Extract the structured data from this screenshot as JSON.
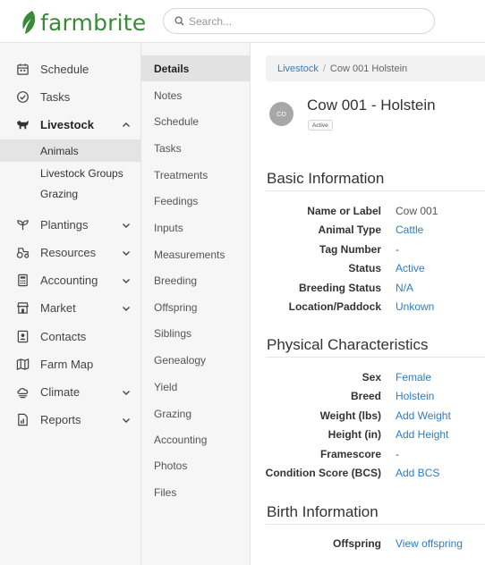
{
  "logo": {
    "text": "farmbrite"
  },
  "search": {
    "placeholder": "Search..."
  },
  "sidebar": {
    "items": [
      {
        "label": "Schedule",
        "icon": "calendar-icon"
      },
      {
        "label": "Tasks",
        "icon": "check-circle-icon"
      },
      {
        "label": "Livestock",
        "icon": "livestock-icon",
        "expanded": true
      },
      {
        "label": "Plantings",
        "icon": "sprout-icon"
      },
      {
        "label": "Resources",
        "icon": "tractor-icon"
      },
      {
        "label": "Accounting",
        "icon": "calculator-icon"
      },
      {
        "label": "Market",
        "icon": "market-icon"
      },
      {
        "label": "Contacts",
        "icon": "contact-icon"
      },
      {
        "label": "Farm Map",
        "icon": "map-icon"
      },
      {
        "label": "Climate",
        "icon": "cloud-icon"
      },
      {
        "label": "Reports",
        "icon": "report-icon"
      }
    ],
    "livestock_sub": [
      {
        "label": "Animals"
      },
      {
        "label": "Livestock Groups"
      },
      {
        "label": "Grazing"
      }
    ]
  },
  "subnav": {
    "items": [
      "Details",
      "Notes",
      "Schedule",
      "Tasks",
      "Treatments",
      "Feedings",
      "Inputs",
      "Measurements",
      "Breeding",
      "Offspring",
      "Siblings",
      "Genealogy",
      "Yield",
      "Grazing",
      "Accounting",
      "Photos",
      "Files"
    ]
  },
  "breadcrumb": {
    "link": "Livestock",
    "separator": "/",
    "current": "Cow 001 Holstein"
  },
  "animal": {
    "initials": "CD",
    "title": "Cow 001 - Holstein",
    "status": "Active"
  },
  "basic": {
    "title": "Basic Information",
    "rows": [
      {
        "label": "Name or Label",
        "value": "Cow 001"
      },
      {
        "label": "Animal Type",
        "value": "Cattle"
      },
      {
        "label": "Tag Number",
        "value": "-"
      },
      {
        "label": "Status",
        "value": "Active"
      },
      {
        "label": "Breeding Status",
        "value": "N/A"
      },
      {
        "label": "Location/Paddock",
        "value": "Unkown"
      }
    ]
  },
  "physical": {
    "title": "Physical Characteristics",
    "rows": [
      {
        "label": "Sex",
        "value": "Female"
      },
      {
        "label": "Breed",
        "value": "Holstein"
      },
      {
        "label": "Weight (lbs)",
        "value": "Add Weight"
      },
      {
        "label": "Height (in)",
        "value": "Add Height"
      },
      {
        "label": "Framescore",
        "value": "-"
      },
      {
        "label": "Condition Score (BCS)",
        "value": "Add BCS"
      }
    ]
  },
  "birth": {
    "title": "Birth Information",
    "rows": [
      {
        "label": "Offspring",
        "value": "View offspring"
      }
    ]
  },
  "colors": {
    "brand_green": "#3a8a3a",
    "link_blue": "#2f7dbf"
  }
}
